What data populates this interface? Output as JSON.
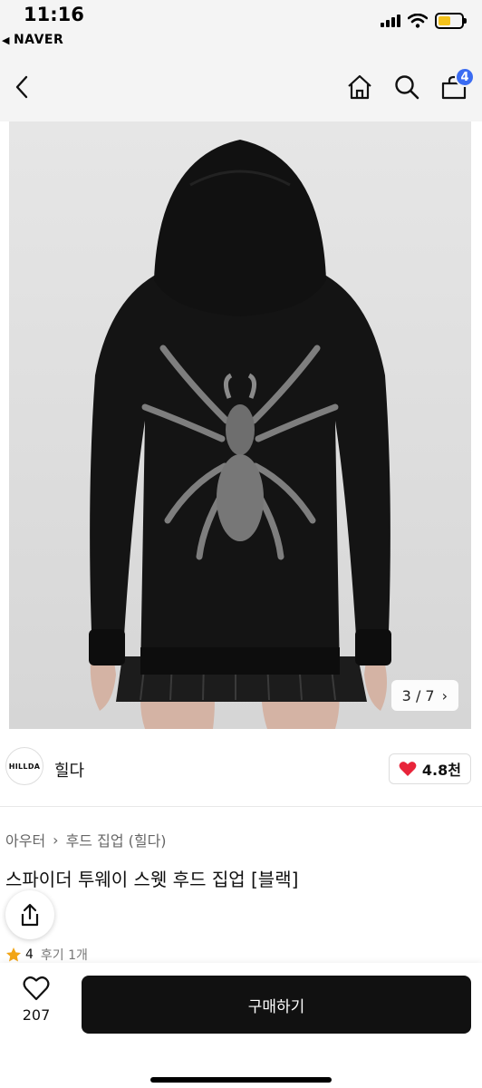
{
  "status_bar": {
    "time": "11:16",
    "back_app": "NAVER",
    "battery_color": "#f4c21b"
  },
  "nav": {
    "cart_count": "4",
    "icons": [
      "back-icon",
      "home-icon",
      "search-icon",
      "cart-icon"
    ],
    "badge_color": "#3b6cf2"
  },
  "gallery": {
    "counter": "3 / 7",
    "chevron": "›"
  },
  "brand": {
    "logo_text": "HILLDA",
    "name": "힐다",
    "likes": "4.8천",
    "heart_color": "#e8243a"
  },
  "breadcrumb": {
    "items": [
      "아우터",
      "후드 집업 (힐다)"
    ],
    "separator": "›"
  },
  "product": {
    "title": "스파이더 투웨이 스웻 후드 집업 [블랙]"
  },
  "review": {
    "rating": "4",
    "count": "후기 1개",
    "star_color": "#f2a516"
  },
  "bottom": {
    "wish_count": "207",
    "buy_label": "구매하기"
  }
}
